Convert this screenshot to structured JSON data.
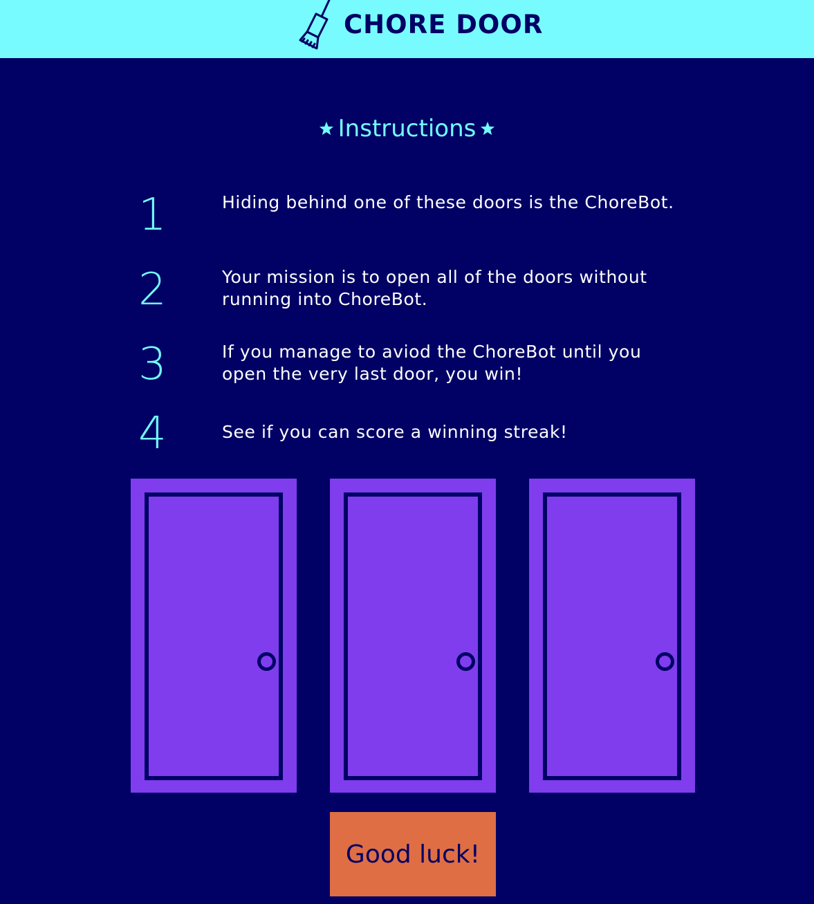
{
  "header": {
    "logo_icon": "broom-icon",
    "title": "CHORE DOOR"
  },
  "instructions": {
    "star_icon": "star-icon",
    "title": "Instructions",
    "steps": [
      {
        "number": "1",
        "text": "Hiding behind one of these doors is the ChoreBot."
      },
      {
        "number": "2",
        "text": "Your mission is to open all of the doors without running into ChoreBot."
      },
      {
        "number": "3",
        "text": "If you manage to aviod the ChoreBot until you open the very last door, you win!"
      },
      {
        "number": "4",
        "text": "See if you can score a winning streak!"
      }
    ]
  },
  "doors": [
    {
      "icon": "closed-door-icon"
    },
    {
      "icon": "closed-door-icon"
    },
    {
      "icon": "closed-door-icon"
    }
  ],
  "start_button": {
    "label": "Good luck!"
  },
  "colors": {
    "background": "#010165",
    "header": "#78fbff",
    "accent_text": "#73fbfd",
    "door": "#7f3ded",
    "button": "#df6e44"
  }
}
